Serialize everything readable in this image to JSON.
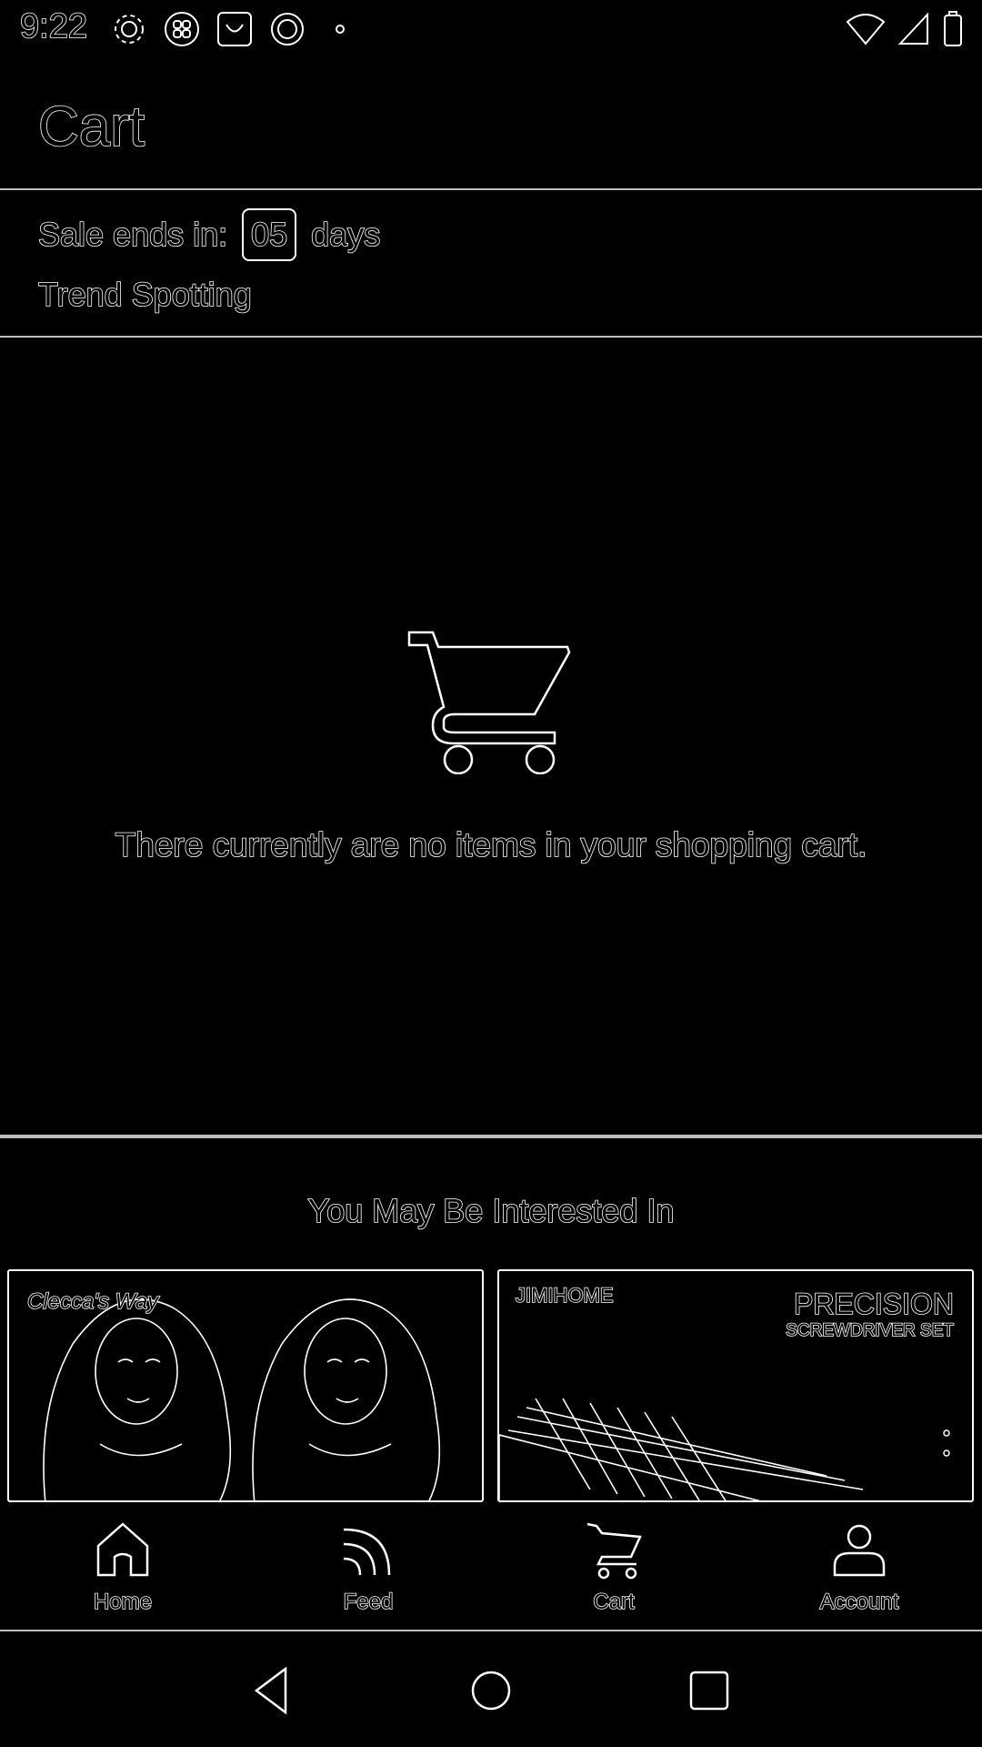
{
  "status_bar": {
    "time": "9:22",
    "left_icons": [
      "gear-icon",
      "grid-icon",
      "bag-icon",
      "sync-icon",
      "dot-icon"
    ],
    "right_icons": [
      "wifi-icon",
      "signal-icon",
      "battery-icon"
    ]
  },
  "header": {
    "title": "Cart"
  },
  "sale": {
    "label": "Sale ends in:",
    "days_value": "05",
    "days_unit": "days",
    "subtitle": "Trend Spotting"
  },
  "empty_cart": {
    "icon": "cart-icon",
    "message": "There currently are no items in your shopping cart."
  },
  "recommendations": {
    "title": "You May Be Interested In",
    "items": [
      {
        "brand": "Clecca's Way",
        "image": "two-women-portrait"
      },
      {
        "brand": "JIMIHOME",
        "title": "PRECISION",
        "subtitle": "SCREWDRIVER SET",
        "image": "screwdriver-set"
      }
    ]
  },
  "bottom_nav": {
    "items": [
      {
        "label": "Home",
        "icon": "home-icon"
      },
      {
        "label": "Feed",
        "icon": "feed-icon"
      },
      {
        "label": "Cart",
        "icon": "cart-icon"
      },
      {
        "label": "Account",
        "icon": "account-icon"
      }
    ]
  },
  "system_nav": {
    "buttons": [
      "back-icon",
      "home-circle-icon",
      "recents-icon"
    ]
  }
}
